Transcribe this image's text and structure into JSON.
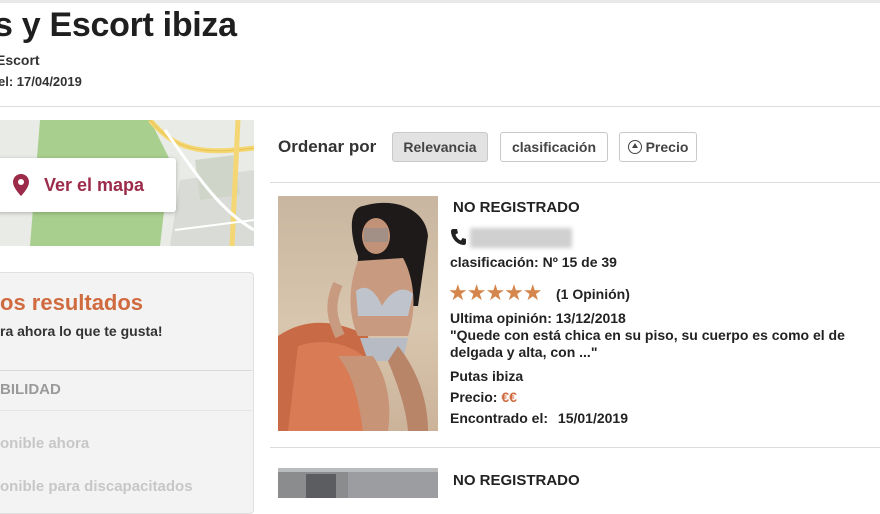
{
  "header": {
    "title": "s y Escort ibiza",
    "subtitle": "Escort",
    "updated": "el: 17/04/2019"
  },
  "map": {
    "button_label": "Ver el mapa",
    "icon": "map-pin-icon"
  },
  "filters": {
    "title": "os resultados",
    "subtitle": "ra ahora lo que te gusta!",
    "section": "BILIDAD",
    "options": [
      "onible ahora",
      "onible para discapacitados"
    ]
  },
  "sort": {
    "label": "Ordenar por",
    "options": [
      "Relevancia",
      "clasificación",
      "Precio"
    ],
    "active": "Relevancia"
  },
  "listings": [
    {
      "status": "NO REGISTRADO",
      "phone_icon": "phone-icon",
      "rank": "clasificación: Nº 15 de 39",
      "rating_stars": 5,
      "rating_text": "(1 Opinión)",
      "last_review": "Ultima opinión: 13/12/2018",
      "quote_line1": "\"Quede con está chica en su piso, su cuerpo es como el de",
      "quote_line2": "delgada y alta, con ...\"",
      "category": "Putas ibiza",
      "price_label": "Precio:",
      "price_value": "€€",
      "found_label": "Encontrado el:",
      "found_date": "15/01/2019"
    },
    {
      "status": "NO REGISTRADO"
    }
  ],
  "colors": {
    "accent_orange": "#d06a3f",
    "map_button_text": "#9c2b4a",
    "stars": "#d4864c"
  }
}
